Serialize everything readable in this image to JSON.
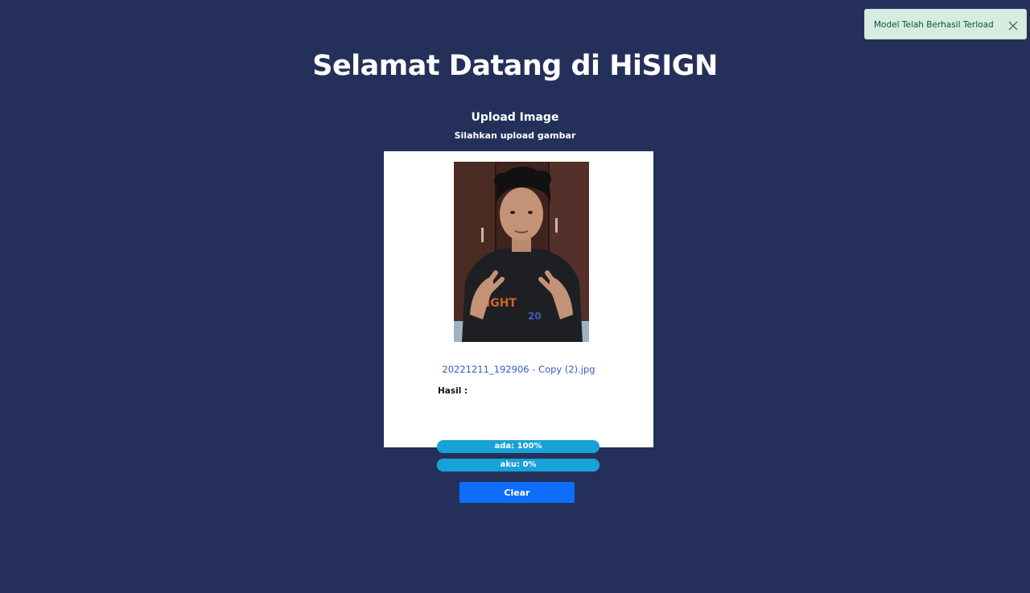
{
  "header": {
    "title": "Selamat Datang di HiSIGN",
    "subtitle": "Upload Image",
    "instruction": "Silahkan upload gambar"
  },
  "upload": {
    "image_icon": "uploaded-photo",
    "filename": "20221211_192906 - Copy (2).jpg",
    "result_label": "Hasil :"
  },
  "predictions": [
    {
      "label": "ada: 100%",
      "value": 1.0
    },
    {
      "label": "aku: 0%",
      "value": 0.0
    }
  ],
  "actions": {
    "clear_label": "Clear"
  },
  "toast": {
    "message": "Model Telah Berhasil Terload",
    "close_icon": "close-icon"
  },
  "colors": {
    "background": "#25305a",
    "bar": "#17a2d8",
    "button": "#0d6efd",
    "toast_bg": "#d6ece1",
    "link": "#2f5fbf"
  }
}
